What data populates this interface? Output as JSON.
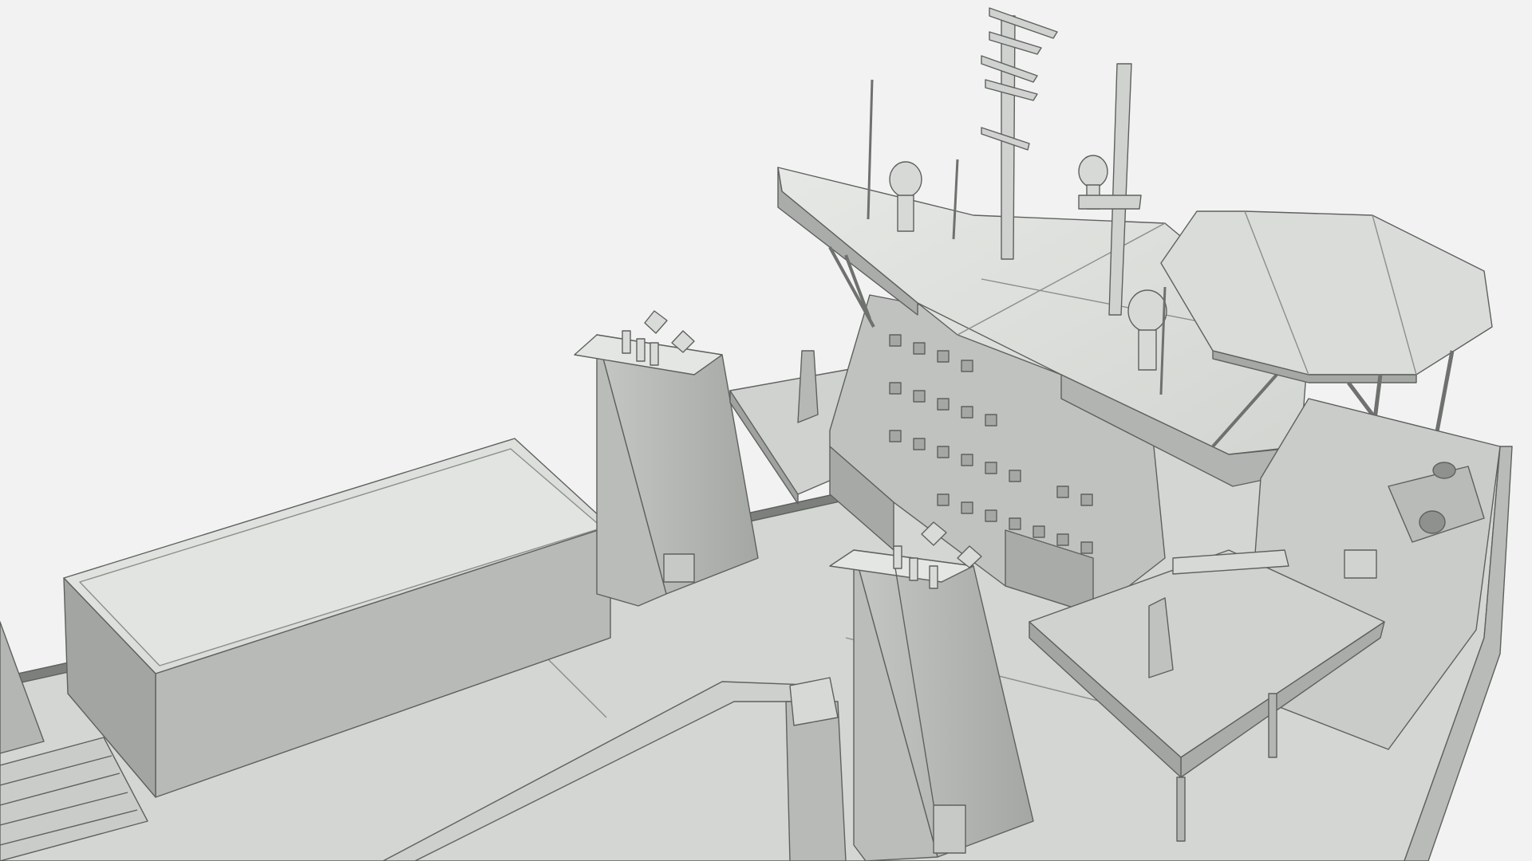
{
  "scene": {
    "subject": "ship-wireframe-render",
    "colors": {
      "background": "#f2f2f2",
      "surface_light": "#dcdfdb",
      "surface_mid": "#c7cac6",
      "surface_dark": "#a9aca8",
      "edge": "#5e615e"
    }
  }
}
